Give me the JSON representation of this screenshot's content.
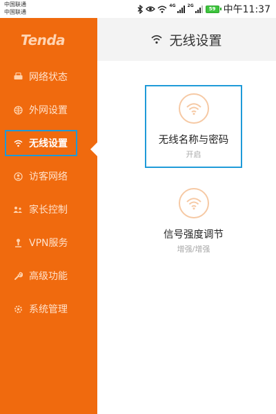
{
  "status_bar": {
    "carrier_1": "中国联通",
    "carrier_2": "中国联通",
    "net_1": "4G",
    "net_2": "2G",
    "battery": "59",
    "time": "中午11:37"
  },
  "sidebar": {
    "logo": "Tenda",
    "items": [
      {
        "label": "网络状态",
        "icon": "monitor-icon"
      },
      {
        "label": "外网设置",
        "icon": "globe-icon"
      },
      {
        "label": "无线设置",
        "icon": "wifi-icon",
        "active": true
      },
      {
        "label": "访客网络",
        "icon": "guest-icon"
      },
      {
        "label": "家长控制",
        "icon": "parental-icon"
      },
      {
        "label": "VPN服务",
        "icon": "vpn-icon"
      },
      {
        "label": "高级功能",
        "icon": "wrench-icon"
      },
      {
        "label": "系统管理",
        "icon": "gear-icon"
      }
    ]
  },
  "header": {
    "title": "无线设置",
    "icon": "wifi-icon"
  },
  "cards": [
    {
      "title": "无线名称与密码",
      "subtitle": "开启",
      "icon": "wifi-icon"
    },
    {
      "title": "信号强度调节",
      "subtitle": "增强/增强",
      "icon": "wifi-icon"
    }
  ],
  "colors": {
    "sidebar_bg": "#f06a0e",
    "highlight_border": "#1e9ad8",
    "card_icon": "#f6c9a4",
    "header_bg": "#f3f3f3"
  }
}
